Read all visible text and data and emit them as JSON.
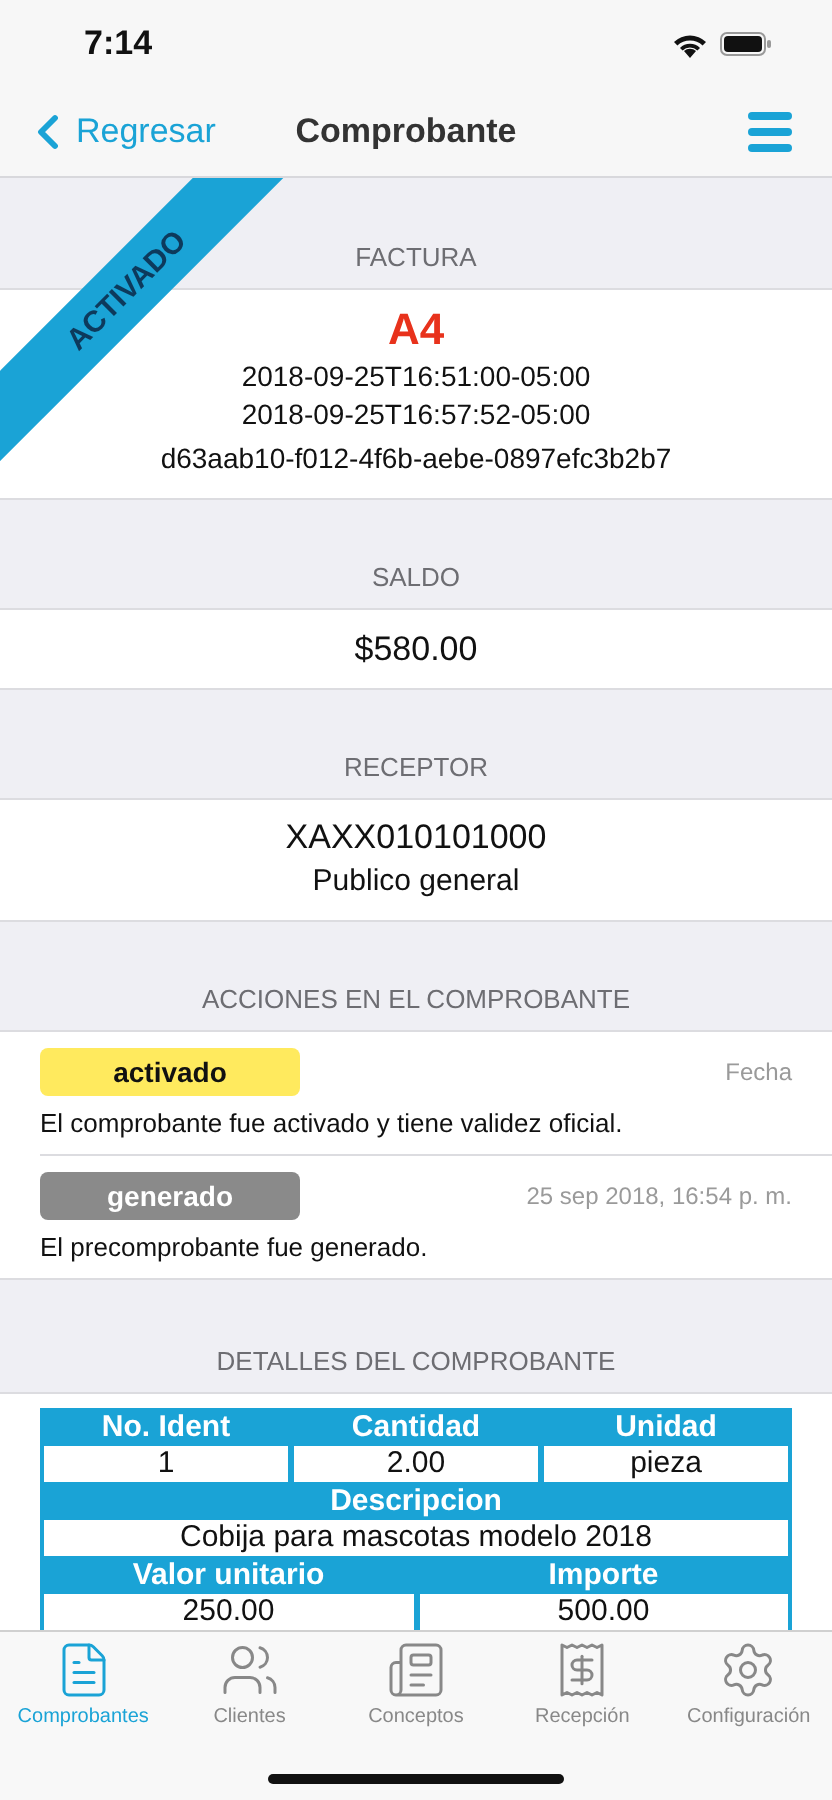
{
  "status_bar": {
    "time": "7:14"
  },
  "nav": {
    "back": "Regresar",
    "title": "Comprobante"
  },
  "ribbon": {
    "label": "ACTIVADO"
  },
  "factura": {
    "header": "FACTURA",
    "serie": "A4",
    "lines": [
      "2018-09-25T16:51:00-05:00",
      "2018-09-25T16:57:52-05:00",
      "d63aab10-f012-4f6b-aebe-0897efc3b2b7"
    ]
  },
  "saldo": {
    "header": "SALDO",
    "value": "$580.00"
  },
  "receptor": {
    "header": "RECEPTOR",
    "rfc": "XAXX010101000",
    "name": "Publico general"
  },
  "acciones": {
    "header": "ACCIONES EN EL COMPROBANTE",
    "items": [
      {
        "tag": "activado",
        "color": "#ffea5e",
        "date": "Fecha",
        "text": "El comprobante fue activado y tiene validez oficial."
      },
      {
        "tag": "generado",
        "color": "#8a8a8a",
        "date": "25 sep 2018, 16:54 p. m.",
        "text": "El precomprobante fue generado."
      }
    ]
  },
  "detalles": {
    "header": "DETALLES DEL COMPROBANTE",
    "table": {
      "row1_headers": [
        "No. Ident",
        "Cantidad",
        "Unidad"
      ],
      "row1_values": [
        "1",
        "2.00",
        "pieza"
      ],
      "row2_header": "Descripcion",
      "row2_value": "Cobija para mascotas modelo 2018",
      "row3_headers": [
        "Valor unitario",
        "Importe"
      ],
      "row3_values": [
        "250.00",
        "500.00"
      ]
    }
  },
  "tab_bar": [
    {
      "label": "Comprobantes",
      "selected": true
    },
    {
      "label": "Clientes",
      "selected": false
    },
    {
      "label": "Conceptos",
      "selected": false
    },
    {
      "label": "Recepción",
      "selected": false
    },
    {
      "label": "Configuración",
      "selected": false
    }
  ]
}
